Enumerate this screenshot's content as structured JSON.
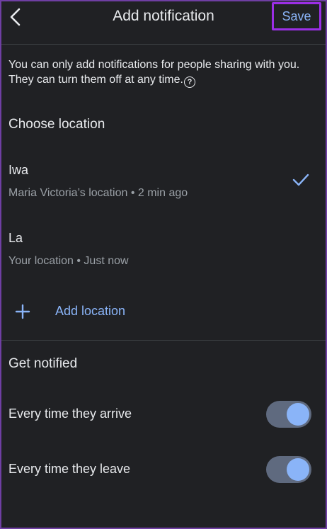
{
  "header": {
    "title": "Add notification",
    "save_label": "Save"
  },
  "info": {
    "text": "You can only add notifications for people sharing with you. They can turn them off at any time."
  },
  "choose_location": {
    "title": "Choose location",
    "items": [
      {
        "name": "Iwa",
        "detail": "Maria Victoria’s location • 2 min ago",
        "selected": true
      },
      {
        "name": "La",
        "detail": "Your location • Just now",
        "selected": false
      }
    ],
    "add_label": "Add location"
  },
  "get_notified": {
    "title": "Get notified",
    "options": [
      {
        "label": "Every time they arrive",
        "enabled": true
      },
      {
        "label": "Every time they leave",
        "enabled": true
      }
    ]
  },
  "colors": {
    "background": "#202124",
    "accent": "#8ab4f8",
    "toggle_track": "#5f6a7f",
    "secondary_text": "#9aa0a6",
    "highlight_border": "#9b2ee6"
  },
  "icons": {
    "back": "back-arrow-icon",
    "help": "help-circle-icon",
    "selected": "checkmark-icon",
    "add": "plus-icon"
  }
}
